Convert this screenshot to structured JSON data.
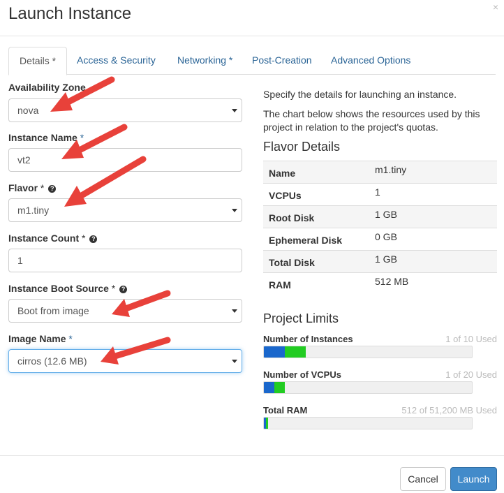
{
  "dialog": {
    "title": "Launch Instance",
    "close_glyph": "×"
  },
  "tabs": [
    {
      "label": "Details",
      "required": " *"
    },
    {
      "label": "Access & Security",
      "required": ""
    },
    {
      "label": "Networking",
      "required": " *"
    },
    {
      "label": "Post-Creation",
      "required": ""
    },
    {
      "label": "Advanced Options",
      "required": ""
    }
  ],
  "form": {
    "availability_zone": {
      "label": "Availability Zone",
      "value": "nova"
    },
    "instance_name": {
      "label": "Instance Name",
      "required": " *",
      "value": "vt2"
    },
    "flavor": {
      "label": "Flavor",
      "required": " *",
      "value": "m1.tiny"
    },
    "instance_count": {
      "label": "Instance Count",
      "required": " *",
      "value": "1"
    },
    "boot_source": {
      "label": "Instance Boot Source",
      "required": " *",
      "value": "Boot from image"
    },
    "image_name": {
      "label": "Image Name",
      "required": " *",
      "value": "cirros (12.6 MB)"
    },
    "help_glyph": "?"
  },
  "info": {
    "intro": "Specify the details for launching an instance.",
    "chart_desc": "The chart below shows the resources used by this project in relation to the project's quotas."
  },
  "flavor_details": {
    "title": "Flavor Details",
    "rows": [
      {
        "key": "Name",
        "value": "m1.tiny"
      },
      {
        "key": "VCPUs",
        "value": "1"
      },
      {
        "key": "Root Disk",
        "value": "1 GB"
      },
      {
        "key": "Ephemeral Disk",
        "value": "0 GB"
      },
      {
        "key": "Total Disk",
        "value": "1 GB"
      },
      {
        "key": "RAM",
        "value": "512 MB"
      }
    ]
  },
  "project_limits": {
    "title": "Project Limits",
    "items": [
      {
        "label": "Number of Instances",
        "value_text": "1 of 10 Used",
        "used_fraction": 0.1,
        "added_fraction": 0.1
      },
      {
        "label": "Number of VCPUs",
        "value_text": "1 of 20 Used",
        "used_fraction": 0.05,
        "added_fraction": 0.05
      },
      {
        "label": "Total RAM",
        "value_text": "512 of 51,200 MB Used",
        "used_fraction": 0.01,
        "added_fraction": 0.01
      }
    ],
    "colors": {
      "used": "#1a67cc",
      "added": "#22cc22",
      "empty": "#f0f0f0"
    }
  },
  "footer": {
    "cancel_label": "Cancel",
    "launch_label": "Launch"
  },
  "annotation_color": "#e8413a"
}
